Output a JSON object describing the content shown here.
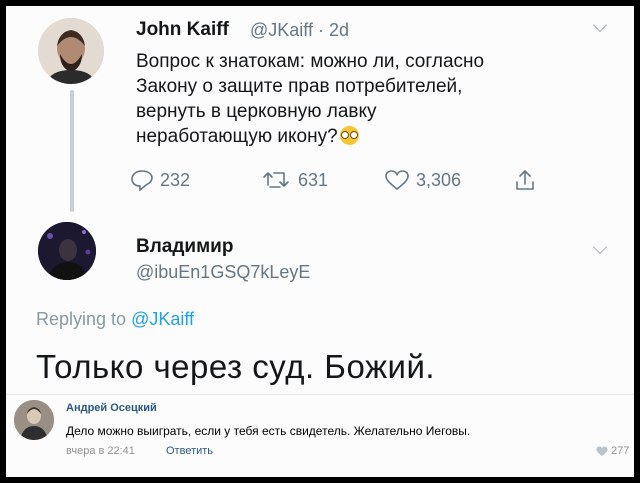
{
  "tweet": {
    "author_name": "John Kaiff",
    "author_handle": "@JKaiff · 2d",
    "text": "Вопрос к знатокам: можно ли, согласно\nЗакону о защите прав потребителей,\nвернуть в церковную лавку\nнеработающую икону?",
    "emoji": "confused-face",
    "replies": "232",
    "retweets": "631",
    "likes": "3,306"
  },
  "reply": {
    "author_name": "Владимир",
    "author_handle": "@ibuEn1GSQ7kLeyE",
    "replying_label": "Replying to",
    "replying_mention": "@JKaiff",
    "text": "Только через суд. Божий."
  },
  "vk_comment": {
    "author_name": "Андрей Осецкий",
    "text": "Дело можно выиграть, если у тебя есть свидетель. Желательно Иеговы.",
    "time": "вчера в 22:41",
    "reply_label": "Ответить",
    "likes": "277"
  },
  "colors": {
    "twitter_blue": "#1da1f2",
    "muted": "#657786",
    "vk_link": "#2a5885"
  }
}
